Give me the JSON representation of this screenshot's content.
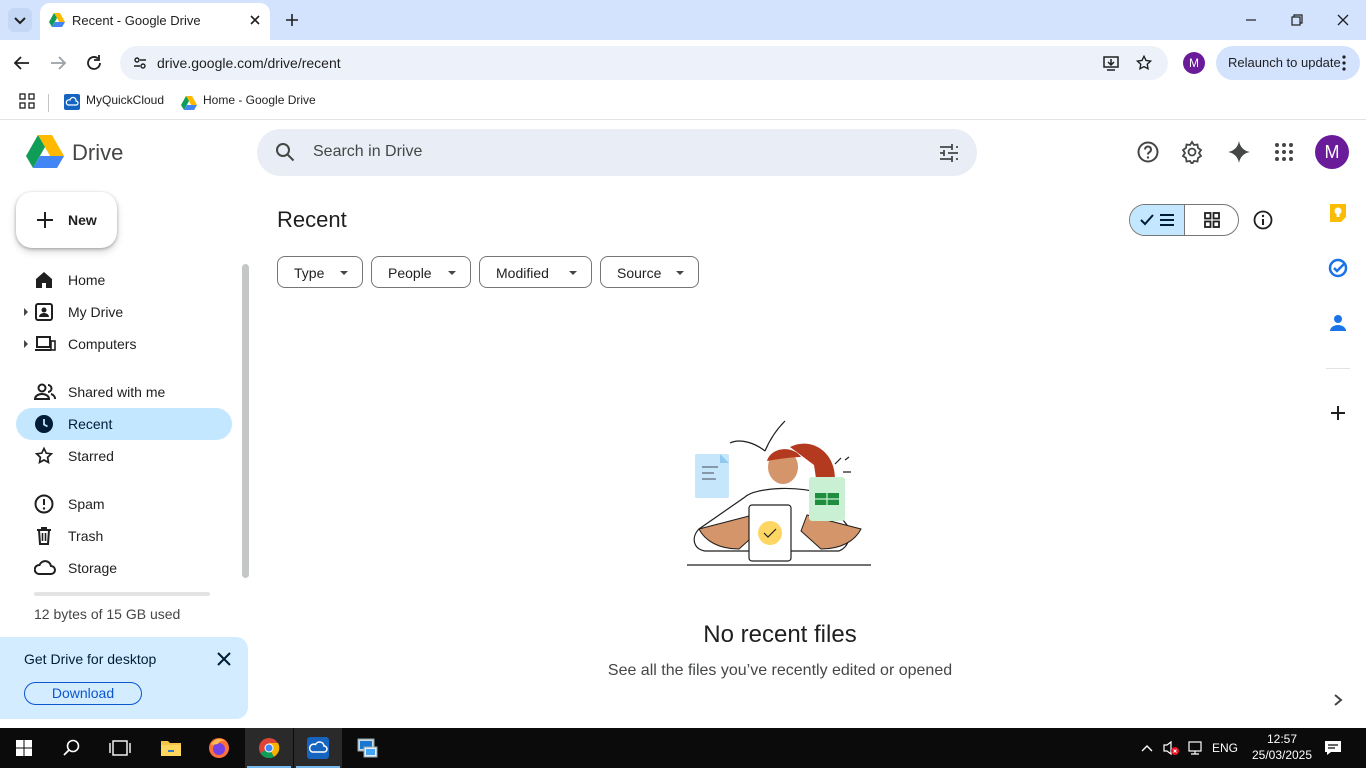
{
  "browser": {
    "tab_title": "Recent - Google Drive",
    "url": "drive.google.com/drive/recent",
    "profile_initial": "M",
    "relaunch_label": "Relaunch to update",
    "bookmarks": [
      {
        "label": "MyQuickCloud"
      },
      {
        "label": "Home - Google Drive"
      }
    ]
  },
  "drive": {
    "product_name": "Drive",
    "search_placeholder": "Search in Drive",
    "account_initial": "M",
    "new_label": "New",
    "nav": [
      {
        "label": "Home"
      },
      {
        "label": "My Drive"
      },
      {
        "label": "Computers"
      },
      {
        "label": "Shared with me"
      },
      {
        "label": "Recent"
      },
      {
        "label": "Starred"
      },
      {
        "label": "Spam"
      },
      {
        "label": "Trash"
      },
      {
        "label": "Storage"
      }
    ],
    "storage_text": "12 bytes of 15 GB used",
    "storage_used_fraction": 0.0,
    "promo": {
      "title": "Get Drive for desktop",
      "button": "Download"
    },
    "page_title": "Recent",
    "filters": [
      {
        "label": "Type"
      },
      {
        "label": "People"
      },
      {
        "label": "Modified"
      },
      {
        "label": "Source"
      }
    ],
    "empty": {
      "title": "No recent files",
      "subtitle": "See all the files you’ve recently edited or opened"
    }
  },
  "taskbar": {
    "language": "ENG",
    "time": "12:57",
    "date": "25/03/2025"
  },
  "colors": {
    "accent": "#0b57d0",
    "active_nav": "#c2e7ff",
    "tabstrip": "#d3e3fd",
    "avatar": "#6a1b9a"
  }
}
